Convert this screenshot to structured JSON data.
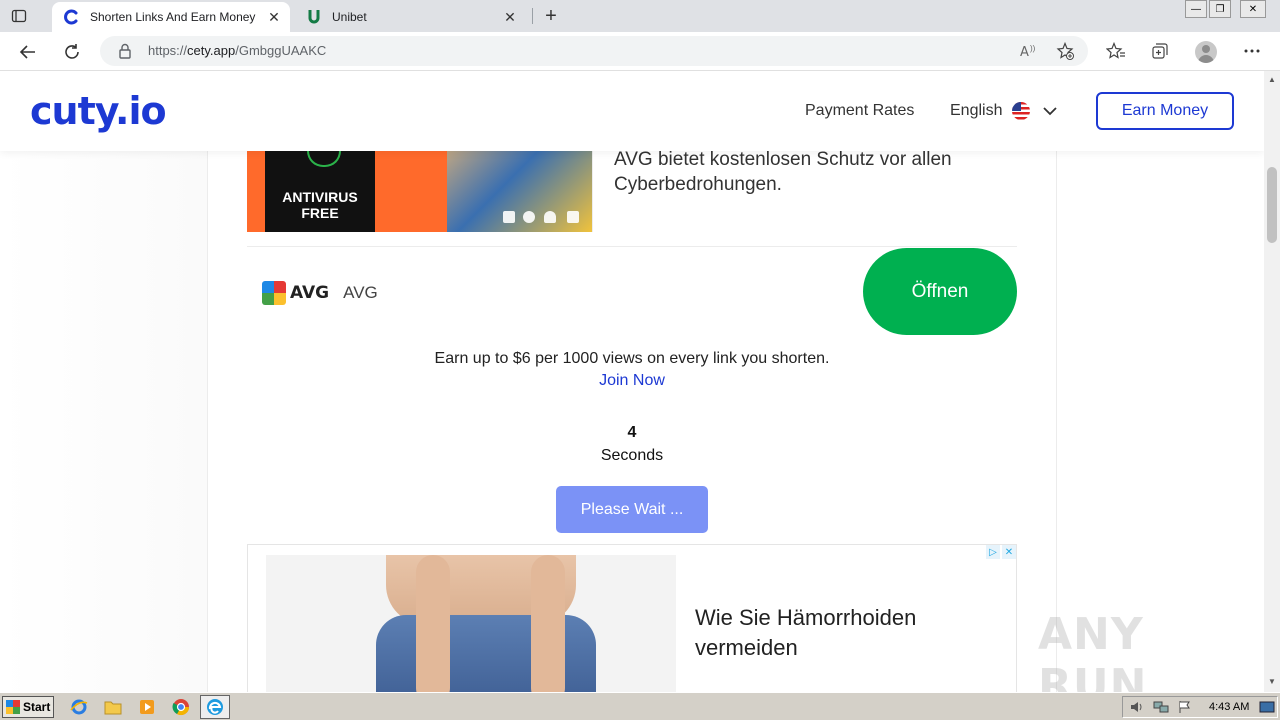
{
  "browser": {
    "tabs": [
      {
        "title": "Shorten Links And Earn Money",
        "active": true,
        "icon": "cuty-favicon-icon"
      },
      {
        "title": "Unibet",
        "active": false,
        "icon": "unibet-favicon-icon"
      }
    ],
    "url_prefix": "https://",
    "url_host": "cety.app",
    "url_path": "/GmbggUAAKC"
  },
  "site": {
    "logo": "cuty.io",
    "nav": {
      "payment_rates": "Payment Rates",
      "language": "English",
      "earn_money": "Earn Money"
    }
  },
  "ad1": {
    "box_line1": "ANTIVIRUS",
    "box_line2": "FREE",
    "text": "AVG bietet kostenlosen Schutz vor allen Cyberbedrohungen.",
    "brand_logo": "AVG",
    "brand_name": "AVG",
    "button": "Öffnen"
  },
  "main": {
    "earn_line": "Earn up to $6 per 1000 views on every link you shorten.",
    "join_now": "Join Now",
    "countdown": "4",
    "countdown_label": "Seconds",
    "wait_button": "Please Wait ..."
  },
  "ad2": {
    "text": "Wie Sie Hämorrhoiden vermeiden"
  },
  "watermark": "ANY RUN",
  "taskbar": {
    "start": "Start",
    "clock": "4:43 AM"
  },
  "colors": {
    "brand": "#1d39d3",
    "open_button": "#00b050",
    "wait_button": "#7b92f6"
  }
}
